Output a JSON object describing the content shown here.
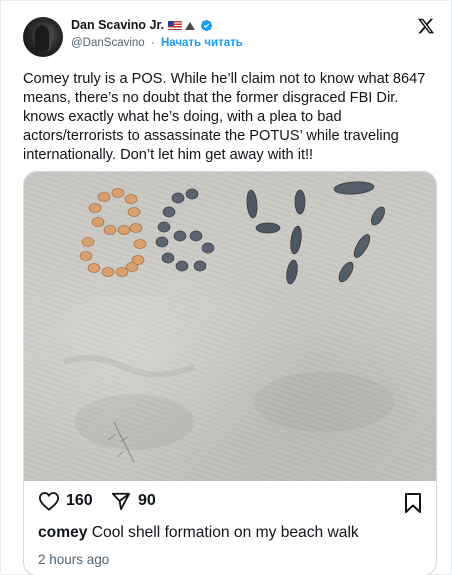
{
  "author": {
    "name": "Dan Scavino Jr.",
    "handle": "@DanScavino",
    "separator": "·",
    "follow_label": "Начать читать",
    "flag_icon": "us-flag-icon",
    "verified_color": "#1d9bf0"
  },
  "platform": {
    "logo_icon": "x-logo-icon"
  },
  "tweet": {
    "text": "Comey truly is a POS. While he’ll claim not to know what 8647 means, there’s no doubt that the former disgraced FBI Dir. knows exactly what he’s doing, with a plea to bad actors/terrorists to assassinate the POTUS’ while traveling internationally. Don’t let him get away with it!!"
  },
  "embedded_post": {
    "image": "seashells arranged on sand",
    "likes": "160",
    "shares": "90",
    "caption_user": "comey",
    "caption_text": "Cool shell formation on my beach walk",
    "time": "2 hours ago"
  }
}
